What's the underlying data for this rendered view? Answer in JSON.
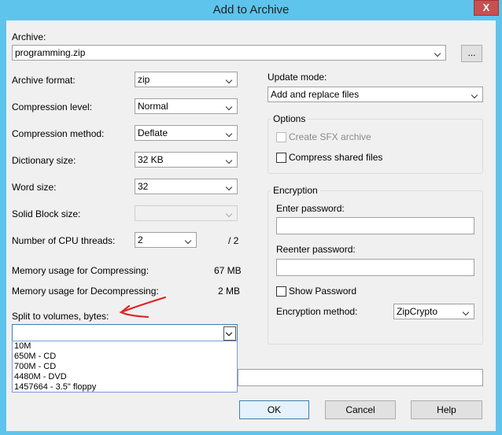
{
  "window": {
    "title": "Add to Archive",
    "close_label": "X"
  },
  "archive": {
    "label": "Archive:",
    "value": "programming.zip",
    "browse_label": "..."
  },
  "left": {
    "archive_format": {
      "label": "Archive format:",
      "value": "zip"
    },
    "compression_level": {
      "label": "Compression level:",
      "value": "Normal"
    },
    "compression_method": {
      "label": "Compression method:",
      "value": "Deflate"
    },
    "dictionary_size": {
      "label": "Dictionary size:",
      "value": "32 KB"
    },
    "word_size": {
      "label": "Word size:",
      "value": "32"
    },
    "solid_block_size": {
      "label": "Solid Block size:",
      "value": ""
    },
    "cpu_threads": {
      "label": "Number of CPU threads:",
      "value": "2",
      "max": "/ 2"
    },
    "mem_compress": {
      "label": "Memory usage for Compressing:",
      "value": "67 MB"
    },
    "mem_decompress": {
      "label": "Memory usage for Decompressing:",
      "value": "2 MB"
    },
    "split": {
      "label": "Split to volumes, bytes:",
      "value": "",
      "options": [
        "10M",
        "650M - CD",
        "700M - CD",
        "4480M - DVD",
        "1457664 - 3.5\" floppy"
      ]
    }
  },
  "right": {
    "update_mode": {
      "label": "Update mode:",
      "value": "Add and replace files"
    },
    "options": {
      "title": "Options",
      "sfx_label": "Create SFX archive",
      "shared_label": "Compress shared files"
    },
    "encryption": {
      "title": "Encryption",
      "enter_password_label": "Enter password:",
      "reenter_password_label": "Reenter password:",
      "show_password_label": "Show Password",
      "method_label": "Encryption method:",
      "method_value": "ZipCrypto"
    }
  },
  "buttons": {
    "ok": "OK",
    "cancel": "Cancel",
    "help": "Help"
  },
  "colors": {
    "title_bar": "#5ec4ec",
    "close_button": "#c75050",
    "dialog_bg": "#f0f0f0",
    "annotation_arrow": "#e0262c"
  }
}
